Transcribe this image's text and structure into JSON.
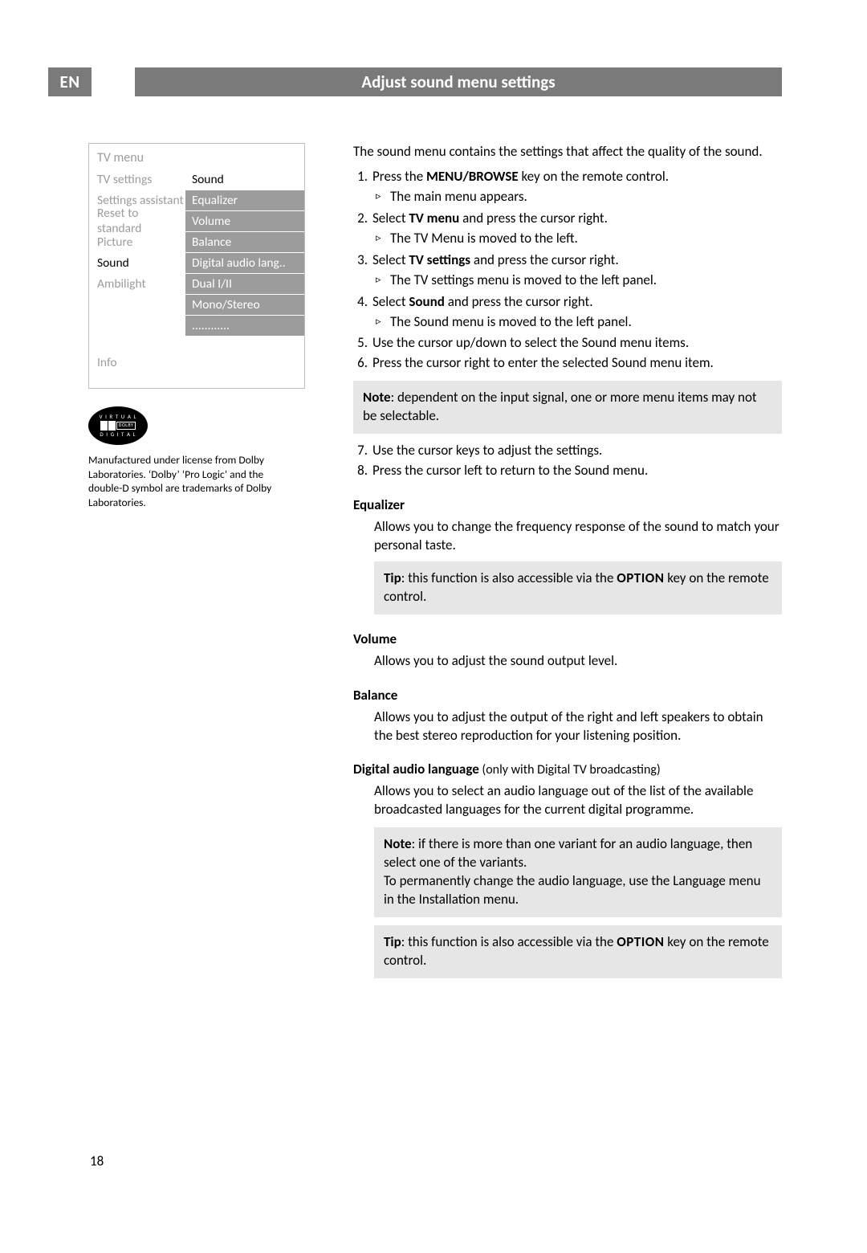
{
  "header": {
    "lang": "EN",
    "title": "Adjust sound menu settings"
  },
  "tvmenu": {
    "title": "TV menu",
    "left": [
      "TV settings",
      "Settings assistant",
      "Reset to standard",
      "Picture",
      "Sound",
      "Ambilight"
    ],
    "left_selected_index": 4,
    "right_header": "Sound",
    "right": [
      "Equalizer",
      "Volume",
      "Balance",
      "Digital audio lang..",
      "Dual I/II",
      "Mono/Stereo",
      "............"
    ],
    "info": "Info"
  },
  "dolby": {
    "top": "V I R T U A L",
    "word": "DOLBY",
    "bottom": "D I G I T A L",
    "caption": "Manufactured under license from Dolby Laboratories. ‘Dolby’ ‘Pro Logic’ and the double-D symbol are trademarks of Dolby Laboratories."
  },
  "intro": "The sound menu contains the settings that affect the quality of the sound.",
  "steps": [
    {
      "n": "1.",
      "pre": "Press the ",
      "bold": "MENU/BROWSE",
      "post": " key on the remote control.",
      "sub": "The main menu appears."
    },
    {
      "n": "2.",
      "pre": "Select ",
      "bold": "TV menu",
      "post": " and press the cursor right.",
      "sub": "The TV Menu is moved to the left."
    },
    {
      "n": "3.",
      "pre": "Select ",
      "bold": "TV settings",
      "post": " and press the cursor right.",
      "sub": "The TV settings menu is moved to the left panel."
    },
    {
      "n": "4.",
      "pre": "Select ",
      "bold": "Sound",
      "post": " and press the cursor right.",
      "sub": "The Sound menu is moved to the left panel."
    },
    {
      "n": "5.",
      "text": "Use the cursor up/down to select the Sound menu items."
    },
    {
      "n": "6.",
      "text": "Press the cursor right to enter the selected Sound menu item."
    }
  ],
  "note_label": "Note",
  "note": ": dependent on the input signal, one or more menu items may not be selectable.",
  "steps2": [
    {
      "n": "7.",
      "text": "Use the cursor keys to adjust the settings."
    },
    {
      "n": "8.",
      "text": "Press the cursor left to return to the Sound menu."
    }
  ],
  "sections": {
    "equalizer": {
      "h": "Equalizer",
      "p": "Allows you to change the frequency response of the sound to match your personal taste.",
      "tip_label": "Tip",
      "tip_pre": ": this function is also accessible via the ",
      "tip_key": "OPTION",
      "tip_post": " key on the remote control."
    },
    "volume": {
      "h": "Volume",
      "p": "Allows you to adjust the sound output level."
    },
    "balance": {
      "h": "Balance",
      "p": "Allows you to adjust the output of the right and left speakers to obtain the best stereo reproduction for your listening position."
    },
    "dal": {
      "h": "Digital audio language",
      "paren": " (only with Digital TV broadcasting)",
      "p": "Allows you to select an audio language out of the list of the available broadcasted languages for the current digital programme.",
      "note_label": "Note",
      "note": ": if there is more than one variant for an audio language, then select one of the variants.",
      "note2": "To permanently change the audio language, use the Language menu in the Installation menu.",
      "tip_label": "Tip",
      "tip_pre": ": this function is also accessible via the ",
      "tip_key": "OPTION",
      "tip_post": " key on the remote control."
    }
  },
  "page_number": "18"
}
